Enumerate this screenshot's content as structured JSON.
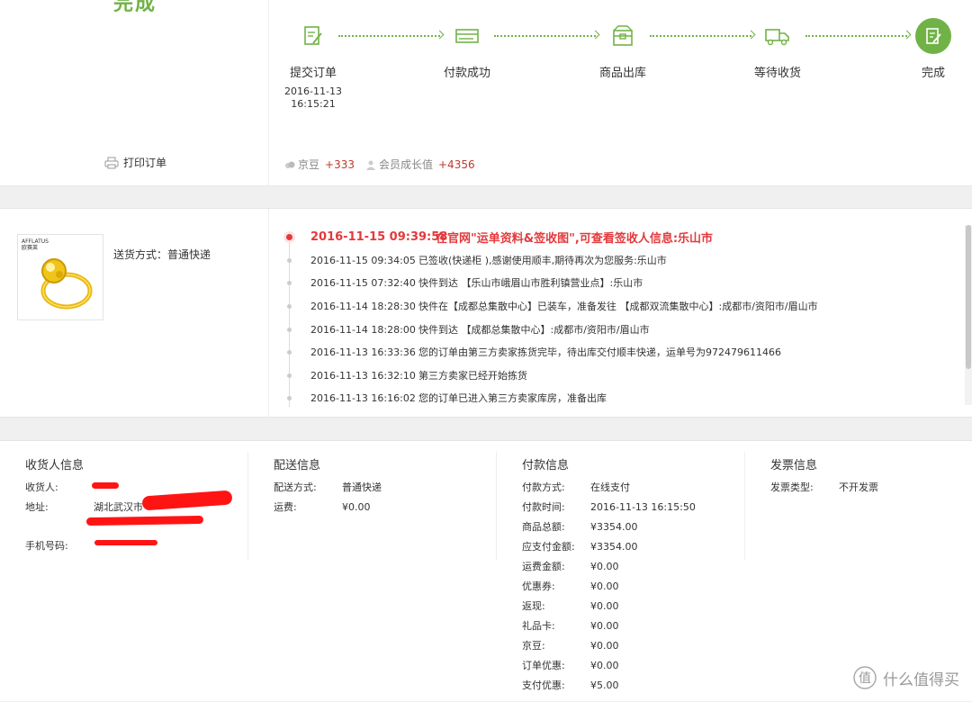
{
  "status": {
    "title": "完成",
    "print_label": "打印订单",
    "steps": [
      {
        "label": "提交订单",
        "date": "2016-11-13",
        "time": "16:15:21",
        "icon": "submit-order-icon"
      },
      {
        "label": "付款成功",
        "date": "",
        "time": "",
        "icon": "payment-icon"
      },
      {
        "label": "商品出库",
        "date": "",
        "time": "",
        "icon": "warehouse-out-icon"
      },
      {
        "label": "等待收货",
        "date": "",
        "time": "",
        "icon": "truck-icon"
      },
      {
        "label": "完成",
        "date": "",
        "time": "",
        "icon": "complete-icon"
      }
    ],
    "rewards": {
      "jingdou_label": "京豆",
      "jingdou_value": "+333",
      "growth_label": "会员成长值",
      "growth_value": "+4356"
    },
    "accent_color": "#71b247"
  },
  "tracking": {
    "product_brand": "AFFLATUS",
    "product_brand_cn": "欧赛莱",
    "ship_method": "送货方式：普通快递",
    "events": [
      {
        "time": "2016-11-15 09:39:58",
        "text": "在官网\"运单资料&签收图\",可查看签收人信息:乐山市"
      },
      {
        "time": "2016-11-15 09:34:05",
        "text": "已签收(快递柜 ),感谢使用顺丰,期待再次为您服务:乐山市"
      },
      {
        "time": "2016-11-15 07:32:40",
        "text": "快件到达 【乐山市峨眉山市胜利镇营业点】:乐山市"
      },
      {
        "time": "2016-11-14 18:28:30",
        "text": "快件在【成都总集散中心】已装车，准备发往 【成都双流集散中心】:成都市/资阳市/眉山市"
      },
      {
        "time": "2016-11-14 18:28:00",
        "text": "快件到达 【成都总集散中心】:成都市/资阳市/眉山市"
      },
      {
        "time": "2016-11-13 16:33:36",
        "text": "您的订单由第三方卖家拣货完毕，待出库交付顺丰快递，运单号为972479611466"
      },
      {
        "time": "2016-11-13 16:32:10",
        "text": "第三方卖家已经开始拣货"
      },
      {
        "time": "2016-11-13 16:16:02",
        "text": "您的订单已进入第三方卖家库房，准备出库"
      }
    ],
    "highlight_color": "#e4393c"
  },
  "info": {
    "receiver": {
      "title": "收货人信息",
      "rows": [
        {
          "k": "收货人:",
          "v": ""
        },
        {
          "k": "地址:",
          "v": "湖北武汉市"
        },
        {
          "k": "手机号码:",
          "v": ""
        }
      ]
    },
    "delivery": {
      "title": "配送信息",
      "rows": [
        {
          "k": "配送方式:",
          "v": "普通快递"
        },
        {
          "k": "运费:",
          "v": "¥0.00"
        }
      ]
    },
    "payment": {
      "title": "付款信息",
      "rows": [
        {
          "k": "付款方式:",
          "v": "在线支付"
        },
        {
          "k": "付款时间:",
          "v": "2016-11-13 16:15:50"
        },
        {
          "k": "商品总额:",
          "v": "¥3354.00"
        },
        {
          "k": "应支付金额:",
          "v": "¥3354.00"
        },
        {
          "k": "运费金额:",
          "v": "¥0.00"
        },
        {
          "k": "优惠券:",
          "v": "¥0.00"
        },
        {
          "k": "返现:",
          "v": "¥0.00"
        },
        {
          "k": "礼品卡:",
          "v": "¥0.00"
        },
        {
          "k": "京豆:",
          "v": "¥0.00"
        },
        {
          "k": "订单优惠:",
          "v": "¥0.00"
        },
        {
          "k": "支付优惠:",
          "v": "¥5.00"
        }
      ]
    },
    "invoice": {
      "title": "发票信息",
      "rows": [
        {
          "k": "发票类型:",
          "v": "不开发票"
        }
      ]
    }
  },
  "watermark": {
    "text": "什么值得买",
    "logo_char": "值"
  }
}
